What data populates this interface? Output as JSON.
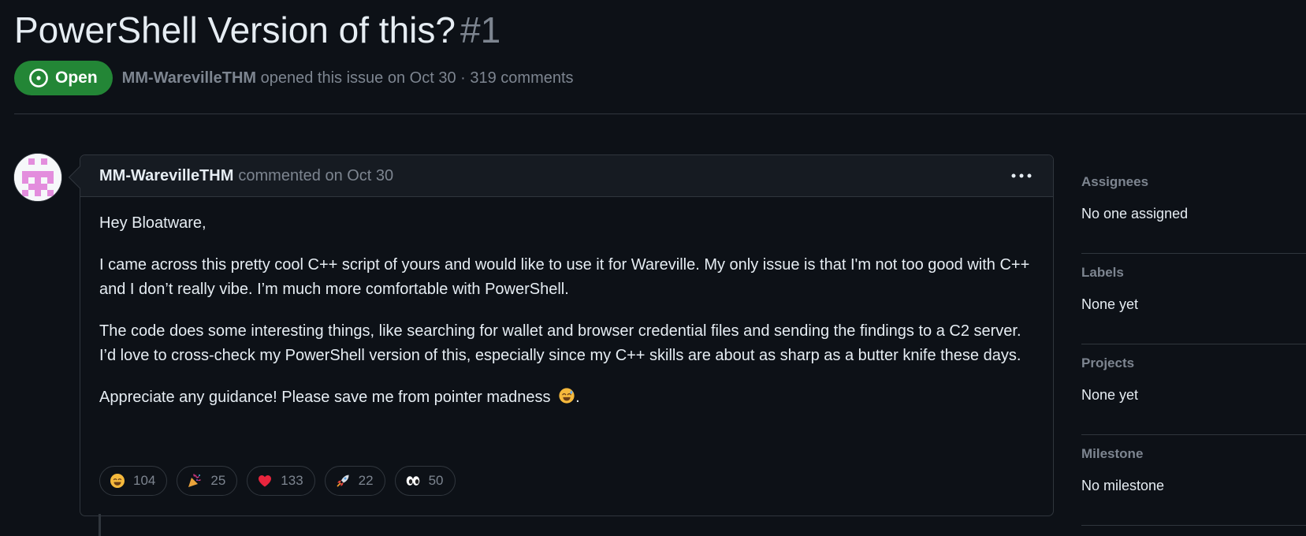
{
  "issue": {
    "title": "PowerShell Version of this?",
    "number": "#1",
    "state": "Open",
    "author": "MM-WarevilleTHM",
    "opened_text": "opened this issue on Oct 30",
    "separator": "·",
    "comments_count": "319 comments",
    "state_color": "#238636"
  },
  "comment": {
    "author": "MM-WarevilleTHM",
    "time_text": "commented on Oct 30",
    "more_icon": "kebab-horizontal-icon",
    "paragraphs": [
      "Hey Bloatware,",
      "I came across this pretty cool C++ script of yours and would like to use it for Wareville. My only issue is that I'm not too good with C++ and I don’t really vibe. I’m much more comfortable with PowerShell.",
      "The code does some interesting things, like searching for wallet and browser credential files and sending the findings to a C2 server. I’d love to cross-check my PowerShell version of this, especially since my C++ skills are about as sharp as a butter knife these days.",
      "Appreciate any guidance! Please save me from pointer madness",
      "."
    ],
    "inline_emoji": "sweat-smile-emoji",
    "reactions": [
      {
        "icon": "smile-emoji",
        "count": "104"
      },
      {
        "icon": "tada-emoji",
        "count": "25"
      },
      {
        "icon": "heart-emoji",
        "count": "133"
      },
      {
        "icon": "rocket-emoji",
        "count": "22"
      },
      {
        "icon": "eyes-emoji",
        "count": "50"
      }
    ]
  },
  "sidebar": {
    "sections": [
      {
        "heading": "Assignees",
        "value": "No one assigned"
      },
      {
        "heading": "Labels",
        "value": "None yet"
      },
      {
        "heading": "Projects",
        "value": "None yet"
      },
      {
        "heading": "Milestone",
        "value": "No milestone"
      }
    ]
  },
  "colors": {
    "background": "#0d1117",
    "border": "#30363d",
    "muted_text": "#7d8590",
    "primary_text": "#e6edf3"
  }
}
